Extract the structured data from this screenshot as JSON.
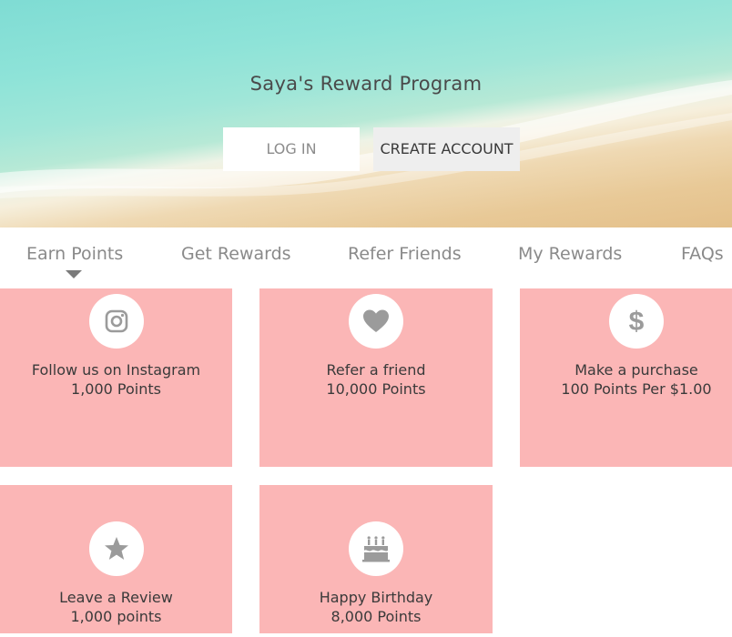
{
  "hero": {
    "title": "Saya's Reward Program",
    "login_label": "LOG IN",
    "create_label": "CREATE ACCOUNT"
  },
  "tabs": [
    {
      "label": "Earn Points",
      "active": true
    },
    {
      "label": "Get Rewards",
      "active": false
    },
    {
      "label": "Refer Friends",
      "active": false
    },
    {
      "label": "My Rewards",
      "active": false
    },
    {
      "label": "FAQs",
      "active": false
    }
  ],
  "cards": [
    {
      "icon": "instagram-icon",
      "title": "Follow us on Instagram",
      "points": "1,000 Points"
    },
    {
      "icon": "heart-icon",
      "title": "Refer a friend",
      "points": "10,000 Points"
    },
    {
      "icon": "dollar-icon",
      "title": "Make a purchase",
      "points": "100 Points Per $1.00"
    },
    {
      "icon": "star-icon",
      "title": "Leave a Review",
      "points": "1,000 points"
    },
    {
      "icon": "birthday-cake-icon",
      "title": "Happy Birthday",
      "points": "8,000 Points"
    }
  ],
  "colors": {
    "card_background": "#fbb6b6",
    "icon_color": "#9b9b9b",
    "text_color": "#3a3a3a",
    "tab_color": "#8a8a8a"
  }
}
